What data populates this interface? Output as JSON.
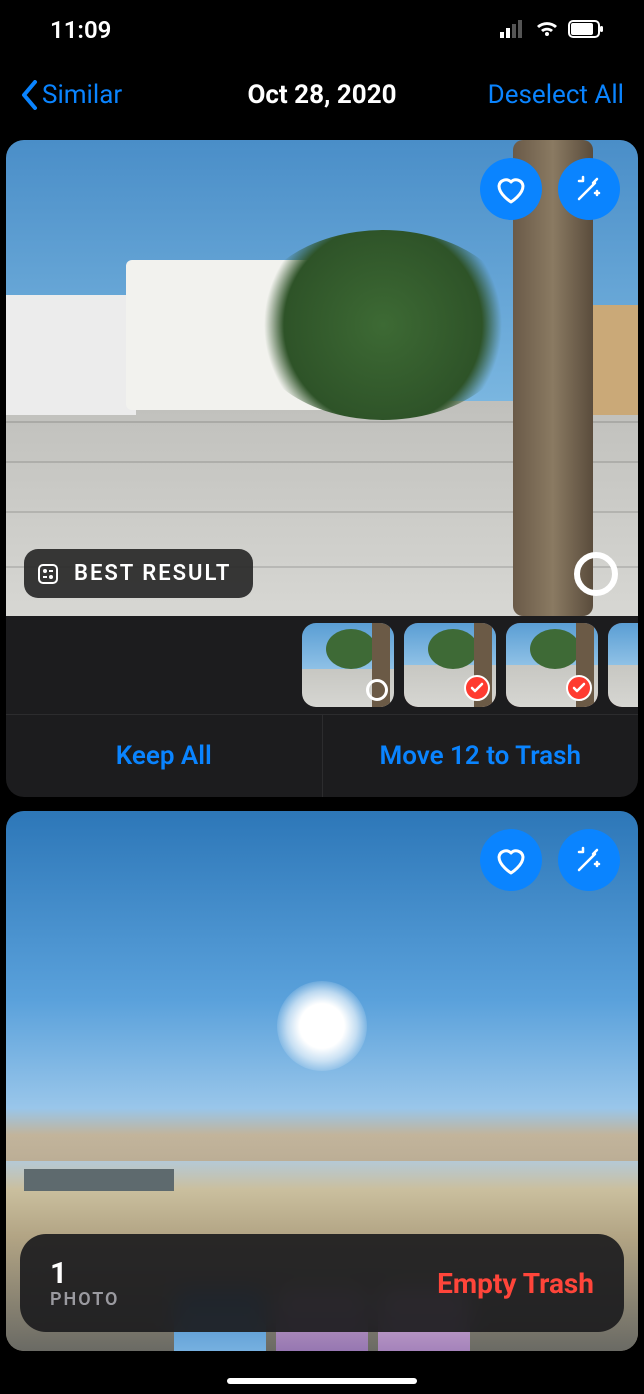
{
  "status": {
    "time": "11:09"
  },
  "nav": {
    "back_label": "Similar",
    "title": "Oct 28, 2020",
    "deselect_label": "Deselect All"
  },
  "card1": {
    "best_label": "BEST RESULT",
    "keep_label": "Keep All",
    "trash_label": "Move 12 to Trash"
  },
  "trash_bar": {
    "count": "1",
    "unit": "PHOTO",
    "action": "Empty Trash"
  }
}
